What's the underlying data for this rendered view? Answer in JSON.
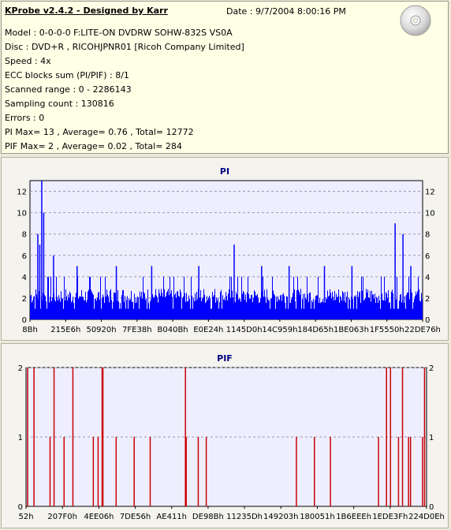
{
  "header": {
    "title": "KProbe v2.4.2 - Designed by Karr",
    "date": "Date : 9/7/2004 8:00:16 PM",
    "lines": [
      "Model : 0-0-0-0 F:LITE-ON DVDRW SOHW-832S  VS0A",
      "Disc : DVD+R , RICOHJPNR01 [Ricoh Company Limited]",
      "Speed : 4x",
      "ECC blocks sum (PI/PIF) : 8/1",
      "Scanned range : 0 - 2286143",
      "Sampling count : 130816",
      "Errors : 0",
      "PI Max= 13 , Average= 0.76 , Total= 12772",
      "PIF Max= 2 , Average= 0.02 , Total= 284"
    ],
    "disc_icon": "cd-disc-icon"
  },
  "colors": {
    "pi_bar": "#0000ff",
    "pif_bar": "#cc0000",
    "title": "#000080",
    "plot_bg": "#eeeeff",
    "grid": "#9a9aa8"
  },
  "chart_data": [
    {
      "type": "bar",
      "title": "PI",
      "ylim": [
        0,
        13
      ],
      "yticks": [
        0,
        2,
        4,
        6,
        8,
        10,
        12
      ],
      "xticks": [
        "8Bh",
        "215E6h",
        "50920h",
        "7FE38h",
        "B040Bh",
        "E0E24h",
        "1145D0h",
        "14C959h",
        "184D65h",
        "1BE063h",
        "1F5550h",
        "22DE76h"
      ],
      "grid": "horizontal dashed",
      "summary": {
        "max": 13,
        "average": 0.76,
        "total": 12772
      },
      "spikes": [
        {
          "x": 0.03,
          "value": 13
        },
        {
          "x": 0.035,
          "value": 10
        },
        {
          "x": 0.02,
          "value": 8
        },
        {
          "x": 0.025,
          "value": 7
        },
        {
          "x": 0.06,
          "value": 6
        },
        {
          "x": 0.12,
          "value": 5
        },
        {
          "x": 0.22,
          "value": 5
        },
        {
          "x": 0.31,
          "value": 5
        },
        {
          "x": 0.43,
          "value": 5
        },
        {
          "x": 0.52,
          "value": 7
        },
        {
          "x": 0.59,
          "value": 5
        },
        {
          "x": 0.66,
          "value": 5
        },
        {
          "x": 0.75,
          "value": 5
        },
        {
          "x": 0.82,
          "value": 5
        },
        {
          "x": 0.93,
          "value": 9
        },
        {
          "x": 0.95,
          "value": 8
        },
        {
          "x": 0.97,
          "value": 5
        }
      ]
    },
    {
      "type": "bar",
      "title": "PIF",
      "ylim": [
        0,
        2
      ],
      "yticks": [
        0,
        1,
        2
      ],
      "xticks": [
        "52h",
        "207F0h",
        "4EE06h",
        "7DE56h",
        "AE411h",
        "DE98Bh",
        "11235Dh",
        "149203h",
        "180051h",
        "1B6EEEh",
        "1EDE3Fh",
        "224D0Eh"
      ],
      "grid": "horizontal dashed",
      "summary": {
        "max": 2,
        "average": 0.02,
        "total": 284
      },
      "spikes": [
        {
          "x": 0.004,
          "value": 2
        },
        {
          "x": 0.02,
          "value": 2
        },
        {
          "x": 0.06,
          "value": 1
        },
        {
          "x": 0.07,
          "value": 2
        },
        {
          "x": 0.095,
          "value": 1
        },
        {
          "x": 0.117,
          "value": 2
        },
        {
          "x": 0.168,
          "value": 1
        },
        {
          "x": 0.18,
          "value": 1
        },
        {
          "x": 0.19,
          "value": 2
        },
        {
          "x": 0.192,
          "value": 2
        },
        {
          "x": 0.225,
          "value": 1
        },
        {
          "x": 0.27,
          "value": 1
        },
        {
          "x": 0.31,
          "value": 1
        },
        {
          "x": 0.398,
          "value": 2
        },
        {
          "x": 0.4,
          "value": 1
        },
        {
          "x": 0.43,
          "value": 1
        },
        {
          "x": 0.45,
          "value": 1
        },
        {
          "x": 0.675,
          "value": 1
        },
        {
          "x": 0.72,
          "value": 1
        },
        {
          "x": 0.76,
          "value": 1
        },
        {
          "x": 0.88,
          "value": 1
        },
        {
          "x": 0.9,
          "value": 2
        },
        {
          "x": 0.91,
          "value": 2
        },
        {
          "x": 0.93,
          "value": 1
        },
        {
          "x": 0.94,
          "value": 2
        },
        {
          "x": 0.955,
          "value": 1
        },
        {
          "x": 0.96,
          "value": 1
        },
        {
          "x": 0.99,
          "value": 1
        },
        {
          "x": 0.995,
          "value": 2
        }
      ]
    }
  ]
}
